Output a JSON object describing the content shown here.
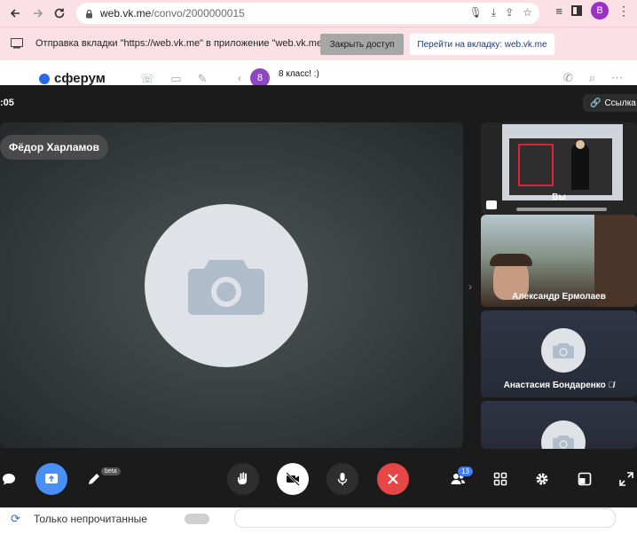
{
  "browser": {
    "url_host": "web.vk.me",
    "url_path": "/convo/2000000015",
    "profile_letter": "B"
  },
  "share_banner": {
    "text": "Отправка вкладки \"https://web.vk.me\" в приложение \"web.vk.me\"...",
    "stop_label": "Закрыть доступ",
    "goto_label": "Перейти на вкладку: web.vk.me"
  },
  "vk": {
    "logo": "сферум",
    "chat_avatar_letter": "8",
    "chat_title": "8 класс! :)",
    "unread_label": "Только непрочитанные"
  },
  "call": {
    "timer": ":05",
    "link_label": "Ссылка",
    "main_speaker": "Фёдор Харламов",
    "tiles": [
      {
        "name": "Вы"
      },
      {
        "name": "Александр Ермолаев"
      },
      {
        "name": "Анастасия Бондаренко"
      },
      {
        "name": ""
      }
    ],
    "beta_label": "beta",
    "participants_count": "13"
  },
  "colors": {
    "end_call": "#e64646",
    "screen_share": "#4a8ff5",
    "profile": "#9b2fc6"
  }
}
